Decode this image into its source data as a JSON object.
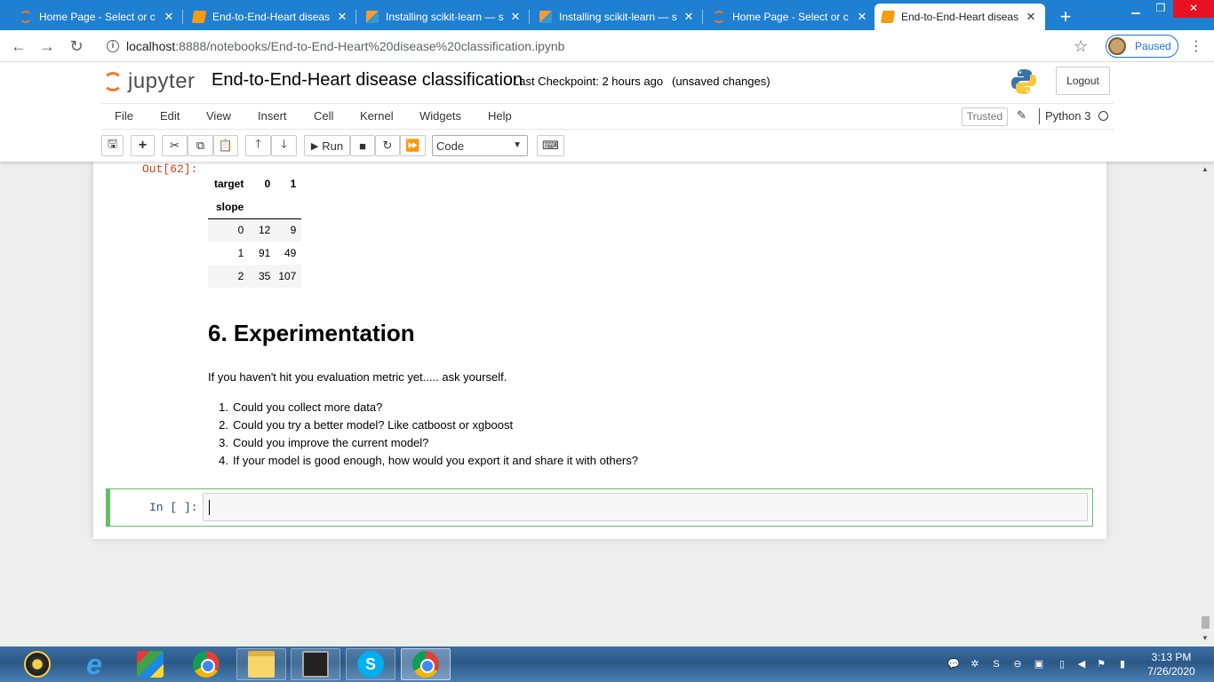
{
  "browser": {
    "tabs": [
      {
        "title": "Home Page - Select or c",
        "icon": "jupyter-icon"
      },
      {
        "title": "End-to-End-Heart diseas",
        "icon": "notebook-icon"
      },
      {
        "title": "Installing scikit-learn — s",
        "icon": "sklearn-icon"
      },
      {
        "title": "Installing scikit-learn — s",
        "icon": "sklearn-icon"
      },
      {
        "title": "Home Page - Select or c",
        "icon": "jupyter-icon"
      },
      {
        "title": "End-to-End-Heart diseas",
        "icon": "notebook-icon"
      }
    ],
    "active_tab_index": 5,
    "url_host": "localhost",
    "url_path": ":8888/notebooks/End-to-End-Heart%20disease%20classification.ipynb",
    "profile_status": "Paused",
    "colors": {
      "tab_bar": "#1f7fd0",
      "profile_accent": "#1a73e8"
    }
  },
  "jupyter": {
    "logo_text": "jupyter",
    "notebook_title": "End-to-End-Heart disease classification",
    "checkpoint": "Last Checkpoint: 2 hours ago",
    "save_status": "(unsaved changes)",
    "logout_label": "Logout",
    "menu": [
      "File",
      "Edit",
      "View",
      "Insert",
      "Cell",
      "Kernel",
      "Widgets",
      "Help"
    ],
    "trusted_label": "Trusted",
    "kernel_name": "Python 3",
    "run_label": "Run",
    "cell_type": "Code",
    "colors": {
      "logo_orange": "#f37726",
      "selected_cell": "#66bb6a",
      "out_prompt": "#d84315",
      "in_prompt": "#303f9f"
    }
  },
  "output": {
    "prompt": "Out[62]:",
    "table": {
      "columns_name": "target",
      "columns": [
        "0",
        "1"
      ],
      "index_name": "slope",
      "rows": [
        {
          "index": "0",
          "values": [
            "12",
            "9"
          ]
        },
        {
          "index": "1",
          "values": [
            "91",
            "49"
          ]
        },
        {
          "index": "2",
          "values": [
            "35",
            "107"
          ]
        }
      ]
    }
  },
  "markdown": {
    "heading": "6. Experimentation",
    "paragraph": "If you haven't hit you evaluation metric yet..... ask yourself.",
    "list": [
      {
        "num": "1.",
        "text": "Could you collect more data?"
      },
      {
        "num": "2.",
        "text": "Could you try a better model? Like catboost or xgboost"
      },
      {
        "num": "3.",
        "text": "Could you improve the current model?"
      },
      {
        "num": "4.",
        "text": "If your model is good enough, how would you export it and share it with others?"
      }
    ]
  },
  "code_cell": {
    "prompt": "In [ ]:",
    "content": ""
  },
  "taskbar": {
    "apps": [
      "start-orb",
      "internet-explorer",
      "photos",
      "chrome",
      "file-explorer",
      "command-prompt",
      "skype",
      "chrome-profile"
    ],
    "time": "3:13 PM",
    "date": "7/26/2020"
  }
}
